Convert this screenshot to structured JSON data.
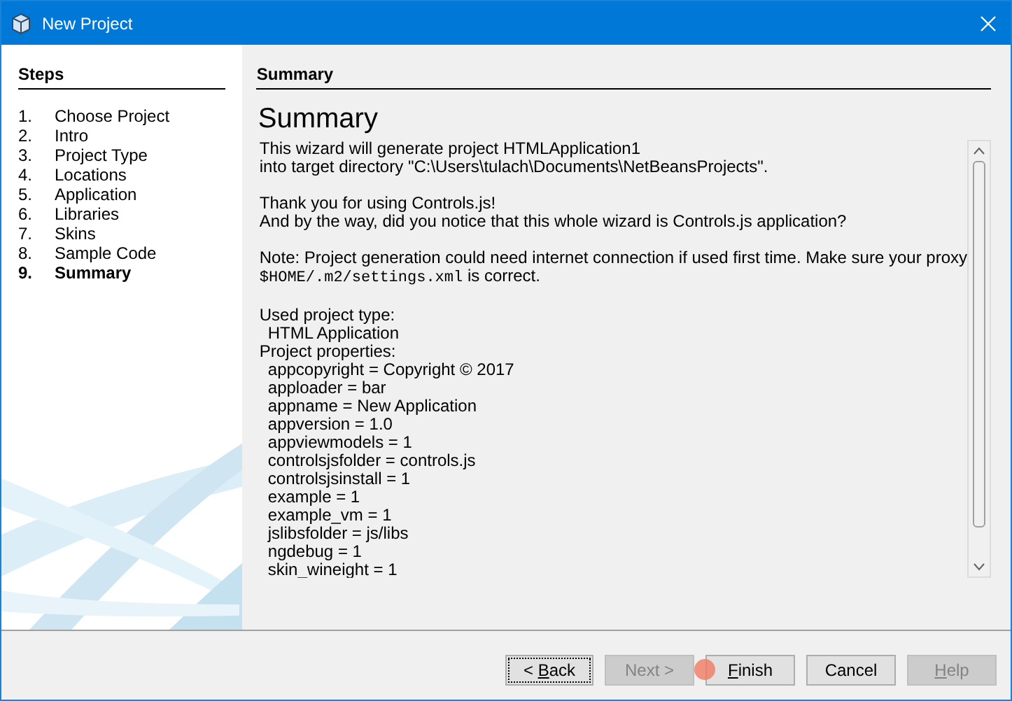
{
  "window": {
    "title": "New Project"
  },
  "steps": {
    "title": "Steps",
    "items": [
      {
        "number": "1.",
        "label": "Choose Project",
        "selected": false
      },
      {
        "number": "2.",
        "label": "Intro",
        "selected": false
      },
      {
        "number": "3.",
        "label": "Project Type",
        "selected": false
      },
      {
        "number": "4.",
        "label": "Locations",
        "selected": false
      },
      {
        "number": "5.",
        "label": "Application",
        "selected": false
      },
      {
        "number": "6.",
        "label": "Libraries",
        "selected": false
      },
      {
        "number": "7.",
        "label": "Skins",
        "selected": false
      },
      {
        "number": "8.",
        "label": "Sample Code",
        "selected": false
      },
      {
        "number": "9.",
        "label": "Summary",
        "selected": true
      }
    ]
  },
  "panel": {
    "title": "Summary",
    "heading": "Summary",
    "paragraphs": [
      {
        "lines": [
          [
            {
              "kind": "plain",
              "text": "This wizard will generate project HTMLApplication1"
            }
          ],
          [
            {
              "kind": "plain",
              "text": "into target directory \"C:\\Users\\tulach\\Documents\\NetBeansProjects\"."
            }
          ]
        ]
      },
      {
        "lines": [
          [
            {
              "kind": "plain",
              "text": "Thank you for using Controls.js!"
            }
          ],
          [
            {
              "kind": "plain",
              "text": "And by the way, did you notice that this whole wizard is Controls.js application?"
            }
          ]
        ]
      },
      {
        "lines": [
          [
            {
              "kind": "plain",
              "text": "Note: Project generation could need internet connection if used first time. Make sure your proxy"
            }
          ],
          [
            {
              "kind": "code",
              "text": "$HOME/.m2/settings.xml"
            },
            {
              "kind": "plain",
              "text": " is correct."
            }
          ]
        ]
      }
    ],
    "listing": [
      {
        "kind": "label",
        "text": "Used project type:"
      },
      {
        "kind": "value",
        "text": "HTML Application"
      },
      {
        "kind": "label",
        "text": "Project properties:"
      },
      {
        "kind": "value",
        "text": "appcopyright = Copyright © 2017"
      },
      {
        "kind": "value",
        "text": "apploader = bar"
      },
      {
        "kind": "value",
        "text": "appname = New Application"
      },
      {
        "kind": "value",
        "text": "appversion = 1.0"
      },
      {
        "kind": "value",
        "text": "appviewmodels = 1"
      },
      {
        "kind": "value",
        "text": "controlsjsfolder = controls.js"
      },
      {
        "kind": "value",
        "text": "controlsjsinstall = 1"
      },
      {
        "kind": "value",
        "text": "example = 1"
      },
      {
        "kind": "value",
        "text": "example_vm = 1"
      },
      {
        "kind": "value",
        "text": "jslibsfolder = js/libs"
      },
      {
        "kind": "value",
        "text": "ngdebug = 1"
      },
      {
        "kind": "value",
        "text": "skin_wineight = 1"
      }
    ]
  },
  "buttons": [
    {
      "before": "< ",
      "key": "B",
      "after": "ack",
      "default": true,
      "disabled": false
    },
    {
      "before": "Next >",
      "default": false,
      "disabled": true
    },
    {
      "key": "F",
      "after": "inish",
      "default": false,
      "disabled": false
    },
    {
      "before": "Cancel",
      "default": false,
      "disabled": false
    },
    {
      "key": "H",
      "after": "elp",
      "default": false,
      "disabled": true
    }
  ]
}
